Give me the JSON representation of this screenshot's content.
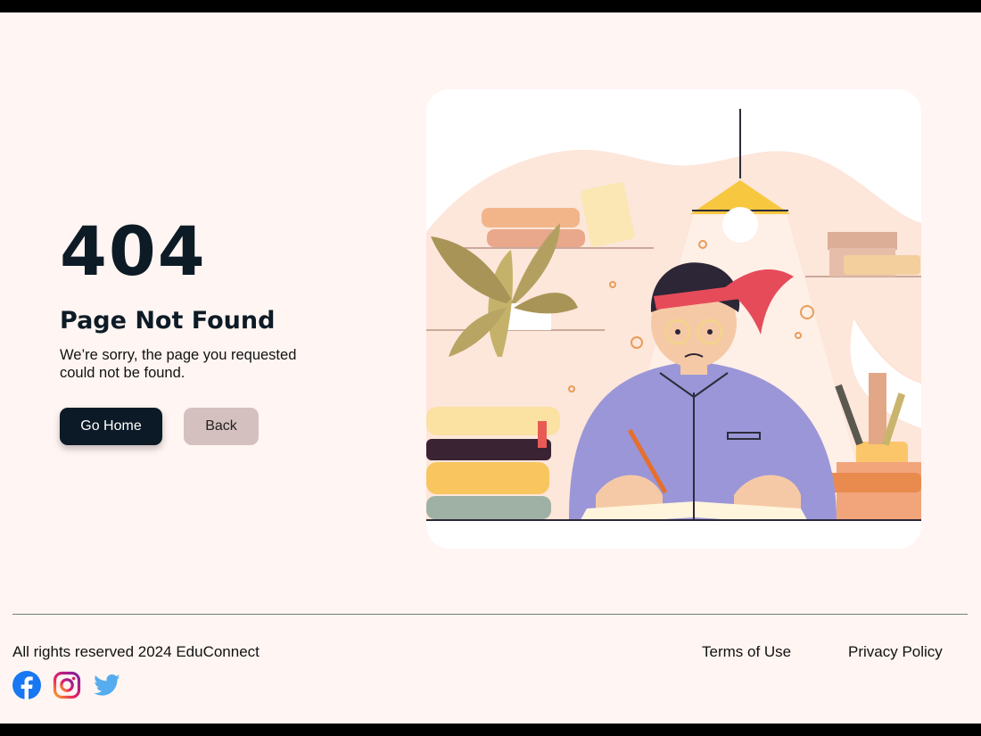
{
  "error": {
    "code": "404",
    "title": "Page Not Found",
    "message": "We’re sorry, the page you requested could not be found."
  },
  "actions": {
    "home_label": "Go Home",
    "back_label": "Back"
  },
  "footer": {
    "copyright": "All rights reserved 2024 EduConnect",
    "links": [
      "Terms of Use",
      "Privacy Policy"
    ],
    "socials": [
      "facebook-icon",
      "instagram-icon",
      "twitter-icon"
    ]
  },
  "colors": {
    "page_bg": "#fff5f2",
    "primary_button": "#0b1a26",
    "secondary_button": "#d4c0bf",
    "heading": "#0d1b26"
  }
}
